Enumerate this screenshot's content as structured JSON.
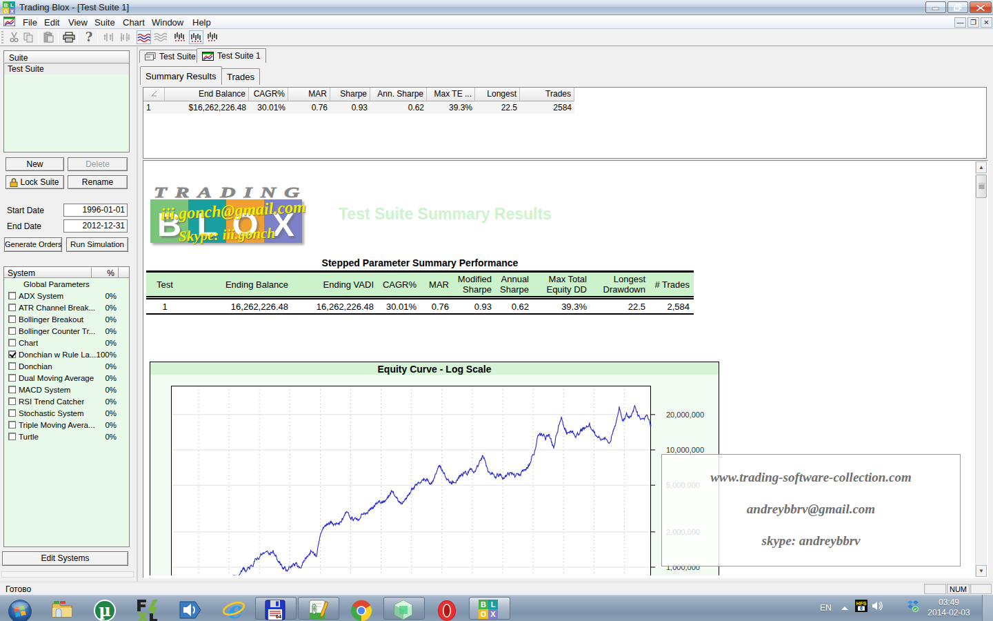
{
  "window": {
    "title": "Trading Blox - [Test Suite 1]"
  },
  "menu": {
    "items": [
      "File",
      "Edit",
      "View",
      "Suite",
      "Chart",
      "Window",
      "Help"
    ]
  },
  "toolbar": {
    "icons": [
      "cut",
      "copy",
      "paste",
      "print",
      "help",
      "stepup",
      "stepdown",
      "waves-color",
      "waves-gray",
      "bars-1",
      "bars-2",
      "bars-3"
    ]
  },
  "sidebar": {
    "suite_header": "Suite",
    "suites": [
      "Test Suite"
    ],
    "new_label": "New",
    "delete_label": "Delete",
    "lock_label": "Lock Suite",
    "rename_label": "Rename",
    "start_date_label": "Start Date",
    "start_date": "1996-01-01",
    "end_date_label": "End Date",
    "end_date": "2012-12-31",
    "generate_label": "Generate Orders",
    "run_label": "Run Simulation",
    "edit_systems_label": "Edit Systems",
    "system_header": "System",
    "percent_header": "%",
    "systems": [
      {
        "label": "Global Parameters",
        "pct": "",
        "has_checkbox": false,
        "checked": false
      },
      {
        "label": "ADX System",
        "pct": "0%",
        "has_checkbox": true,
        "checked": false
      },
      {
        "label": "ATR Channel Break...",
        "pct": "0%",
        "has_checkbox": true,
        "checked": false
      },
      {
        "label": "Bollinger Breakout",
        "pct": "0%",
        "has_checkbox": true,
        "checked": false
      },
      {
        "label": "Bollinger Counter Tr...",
        "pct": "0%",
        "has_checkbox": true,
        "checked": false
      },
      {
        "label": "Chart",
        "pct": "0%",
        "has_checkbox": true,
        "checked": false
      },
      {
        "label": "Donchian w Rule La...",
        "pct": "100%",
        "has_checkbox": true,
        "checked": true
      },
      {
        "label": "Donchian",
        "pct": "0%",
        "has_checkbox": true,
        "checked": false
      },
      {
        "label": "Dual Moving Average",
        "pct": "0%",
        "has_checkbox": true,
        "checked": false
      },
      {
        "label": "MACD System",
        "pct": "0%",
        "has_checkbox": true,
        "checked": false
      },
      {
        "label": "RSI Trend Catcher",
        "pct": "0%",
        "has_checkbox": true,
        "checked": false
      },
      {
        "label": "Stochastic System",
        "pct": "0%",
        "has_checkbox": true,
        "checked": false
      },
      {
        "label": "Triple Moving Avera...",
        "pct": "0%",
        "has_checkbox": true,
        "checked": false
      },
      {
        "label": "Turtle",
        "pct": "0%",
        "has_checkbox": true,
        "checked": false
      }
    ]
  },
  "tabs": {
    "doc_tabs": [
      {
        "label": "Test Suite"
      },
      {
        "label": "Test Suite 1"
      }
    ],
    "active_doc_tab": 1,
    "view_tabs": [
      {
        "label": "Summary Results"
      },
      {
        "label": "Trades"
      }
    ],
    "active_view_tab": 0
  },
  "grid": {
    "columns": [
      "",
      "End Balance",
      "CAGR%",
      "MAR",
      "Sharpe",
      "Ann. Sharpe",
      "Max TE ...",
      "Longest ...",
      "Trades"
    ],
    "row": [
      "1",
      "$16,262,226.48",
      "30.01%",
      "0.76",
      "0.93",
      "0.62",
      "39.3%",
      "22.5",
      "2584"
    ]
  },
  "report": {
    "logo_trading": "TRADING",
    "logo_blox": [
      "B",
      "L",
      "O",
      "X"
    ],
    "logo_colors": [
      "#7cc47c",
      "#18a0a0",
      "#f0a030",
      "#7b80c8"
    ],
    "logo_watermark_email": "iii.gonch@gmail.com",
    "logo_watermark_skype": "Skype: iii.gonch",
    "title": "Test Suite Summary Results",
    "table_title": "Stepped Parameter Summary Performance",
    "table_headers": [
      "Test",
      "Ending Balance",
      "Ending VADI",
      "CAGR%",
      "MAR",
      "Modified Sharpe",
      "Annual Sharpe",
      "Max Total Equity DD",
      "Longest Drawdown",
      "# Trades"
    ],
    "table_row": [
      "1",
      "16,262,226.48",
      "16,262,226.48",
      "30.01%",
      "0.76",
      "0.93",
      "0.62",
      "39.3%",
      "22.5",
      "2,584"
    ],
    "watermark_lines": [
      "www.trading-software-collection.com",
      "andreybbrv@gmail.com",
      "skype: andreybbrv"
    ]
  },
  "chart_data": {
    "type": "line",
    "title": "Equity Curve - Log Scale",
    "scale": "log",
    "ylabels": [
      "20,000,000",
      "10,000,000",
      "5,000,000",
      "2,000,000",
      "1,000,000"
    ],
    "yvalues": [
      20000000,
      10000000,
      5000000,
      2000000,
      1000000
    ],
    "x_range_dates": [
      "1996-01-01",
      "2012-12-31"
    ],
    "end_value": 16262226.48,
    "series_color": "#2a2ad0",
    "anchors_x_value_musd": [
      [
        245,
        0.72
      ],
      [
        300,
        0.74
      ],
      [
        340,
        0.82
      ],
      [
        357,
        1.0
      ],
      [
        372,
        1.22
      ],
      [
        385,
        1.3
      ],
      [
        393,
        1.42
      ],
      [
        400,
        1.1
      ],
      [
        414,
        0.93
      ],
      [
        424,
        1.08
      ],
      [
        433,
        1.0
      ],
      [
        449,
        1.45
      ],
      [
        456,
        1.28
      ],
      [
        462,
        1.9
      ],
      [
        472,
        2.36
      ],
      [
        482,
        2.3
      ],
      [
        494,
        2.45
      ],
      [
        500,
        2.9
      ],
      [
        508,
        2.75
      ],
      [
        517,
        2.45
      ],
      [
        530,
        3.1
      ],
      [
        543,
        3.55
      ],
      [
        552,
        3.6
      ],
      [
        565,
        4.3
      ],
      [
        572,
        4.0
      ],
      [
        580,
        3.45
      ],
      [
        592,
        4.4
      ],
      [
        601,
        5.3
      ],
      [
        612,
        5.6
      ],
      [
        624,
        5.18
      ],
      [
        635,
        7.3
      ],
      [
        642,
        6.0
      ],
      [
        652,
        5.4
      ],
      [
        665,
        6.0
      ],
      [
        676,
        6.5
      ],
      [
        685,
        6.6
      ],
      [
        697,
        9.1
      ],
      [
        706,
        6.7
      ],
      [
        715,
        6.3
      ],
      [
        727,
        6.0
      ],
      [
        738,
        6.4
      ],
      [
        748,
        5.9
      ],
      [
        757,
        6.6
      ],
      [
        766,
        8.2
      ],
      [
        772,
        9.5
      ],
      [
        777,
        13.3
      ],
      [
        788,
        12.5
      ],
      [
        793,
        14.0
      ],
      [
        798,
        10.9
      ],
      [
        800,
        10.3
      ],
      [
        807,
        16.5
      ],
      [
        811,
        19.2
      ],
      [
        819,
        13.8
      ],
      [
        826,
        14.5
      ],
      [
        833,
        13.5
      ],
      [
        840,
        15.0
      ],
      [
        848,
        16.0
      ],
      [
        852,
        16.4
      ],
      [
        861,
        13.5
      ],
      [
        870,
        12.5
      ],
      [
        882,
        12.0
      ],
      [
        890,
        16.8
      ],
      [
        895,
        22.8
      ],
      [
        900,
        18.0
      ],
      [
        906,
        20.0
      ],
      [
        912,
        18.5
      ],
      [
        917,
        22.5
      ],
      [
        922,
        19.5
      ],
      [
        928,
        18.0
      ],
      [
        934,
        19.5
      ],
      [
        941,
        16.26
      ]
    ]
  },
  "statusbar": {
    "ready": "Готово",
    "num": "NUM"
  },
  "taskbar": {
    "icons": [
      "start-orb",
      "explorer",
      "utorrent",
      "forex-tester",
      "volume-app",
      "internet-explorer",
      "floppy-save",
      "notepad-editor",
      "chrome",
      "green-cube",
      "opera",
      "trading-blox"
    ],
    "tray": {
      "lang": "EN",
      "time": "03:49",
      "date": "2014-02-03"
    }
  }
}
